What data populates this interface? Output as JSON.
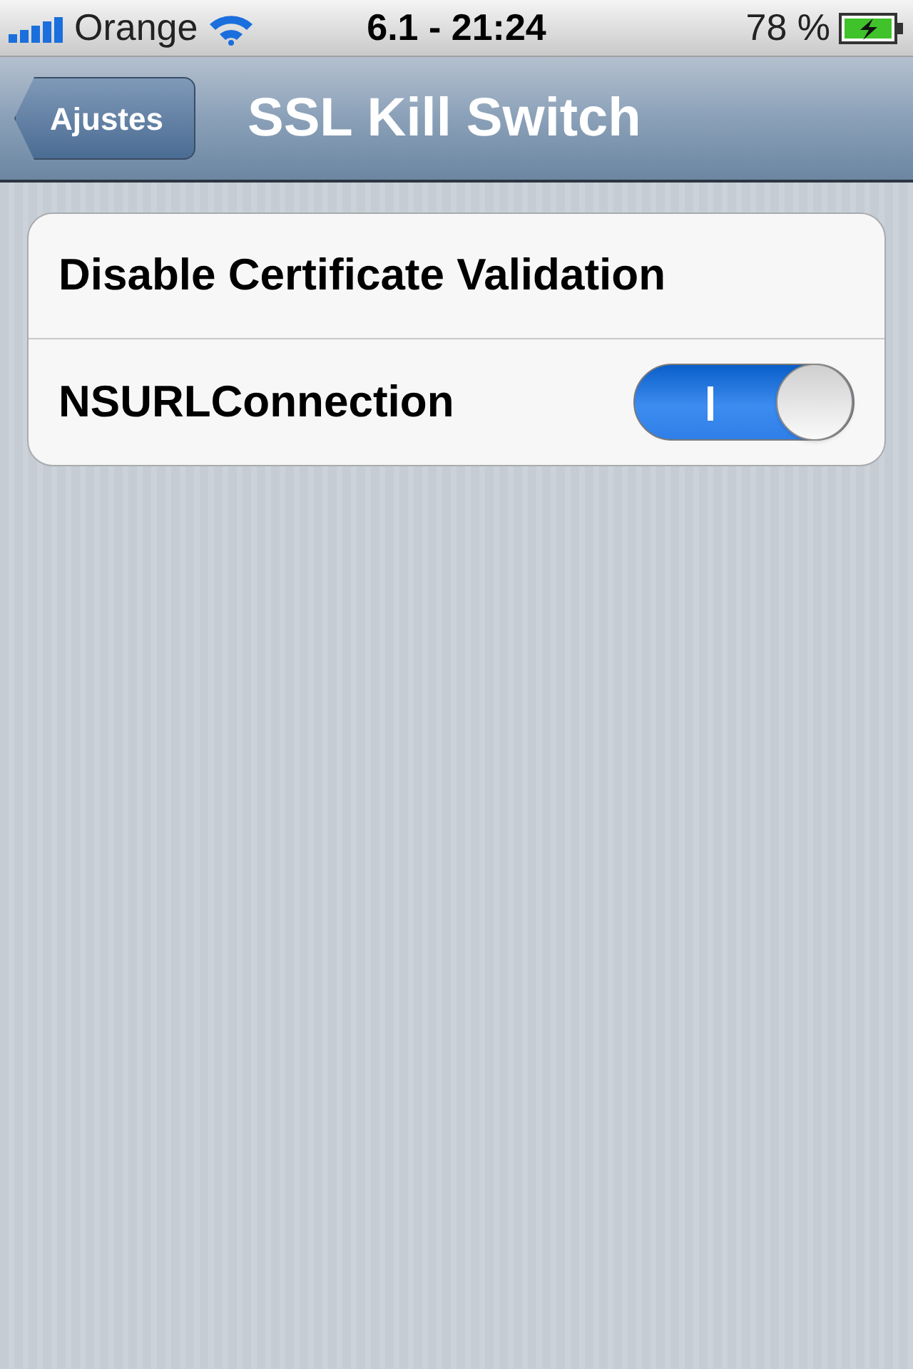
{
  "status_bar": {
    "carrier": "Orange",
    "time": "6.1 - 21:24",
    "battery": "78 %",
    "charging": true
  },
  "nav_bar": {
    "back": "Ajustes",
    "title": "SSL Kill Switch"
  },
  "rows": [
    {
      "kind": "label",
      "label": "Disable Certificate Validation"
    },
    {
      "kind": "switch",
      "label": "NSURLConnection",
      "on": true
    }
  ]
}
